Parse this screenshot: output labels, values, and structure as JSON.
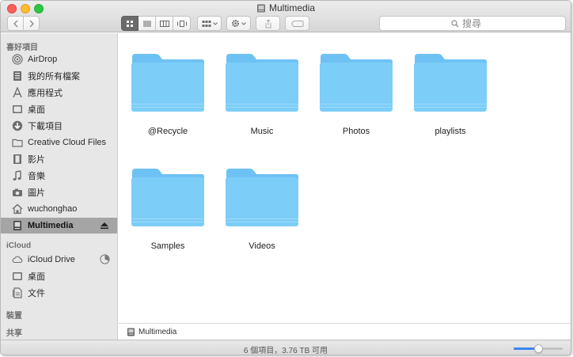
{
  "window": {
    "title": "Multimedia"
  },
  "toolbar": {
    "search_placeholder": "搜尋",
    "view_modes": [
      "icon",
      "list",
      "column",
      "cover-flow"
    ],
    "active_view": "icon"
  },
  "sidebar": {
    "favorites_header": "喜好項目",
    "favorites": [
      {
        "label": "AirDrop",
        "icon": "airdrop-icon"
      },
      {
        "label": "我的所有檔案",
        "icon": "all-files-icon"
      },
      {
        "label": "應用程式",
        "icon": "applications-icon"
      },
      {
        "label": "桌面",
        "icon": "desktop-icon"
      },
      {
        "label": "下載項目",
        "icon": "downloads-icon"
      },
      {
        "label": "Creative Cloud Files",
        "icon": "folder-icon"
      },
      {
        "label": "影片",
        "icon": "movies-icon"
      },
      {
        "label": "音樂",
        "icon": "music-icon"
      },
      {
        "label": "圖片",
        "icon": "pictures-icon"
      },
      {
        "label": "wuchonghao",
        "icon": "home-icon"
      },
      {
        "label": "Multimedia",
        "icon": "network-drive-icon",
        "selected": true
      }
    ],
    "icloud_header": "iCloud",
    "icloud": [
      {
        "label": "iCloud Drive",
        "icon": "cloud-icon"
      },
      {
        "label": "桌面",
        "icon": "desktop-icon"
      },
      {
        "label": "文件",
        "icon": "documents-icon"
      }
    ],
    "devices_header": "裝置",
    "shared_header": "共享"
  },
  "folders": [
    {
      "label": "@Recycle"
    },
    {
      "label": "Music"
    },
    {
      "label": "Photos"
    },
    {
      "label": "playlists"
    },
    {
      "label": "Samples"
    },
    {
      "label": "Videos"
    }
  ],
  "pathbar": {
    "label": "Multimedia"
  },
  "status": {
    "text": "6 個項目，3.76 TB 可用",
    "icon_size_slider": 0.5
  },
  "colors": {
    "folder_top": "#6ec2f3",
    "folder_body": "#7ccdf8",
    "selection": "#a5a5a5",
    "accent": "#3b86f7"
  }
}
